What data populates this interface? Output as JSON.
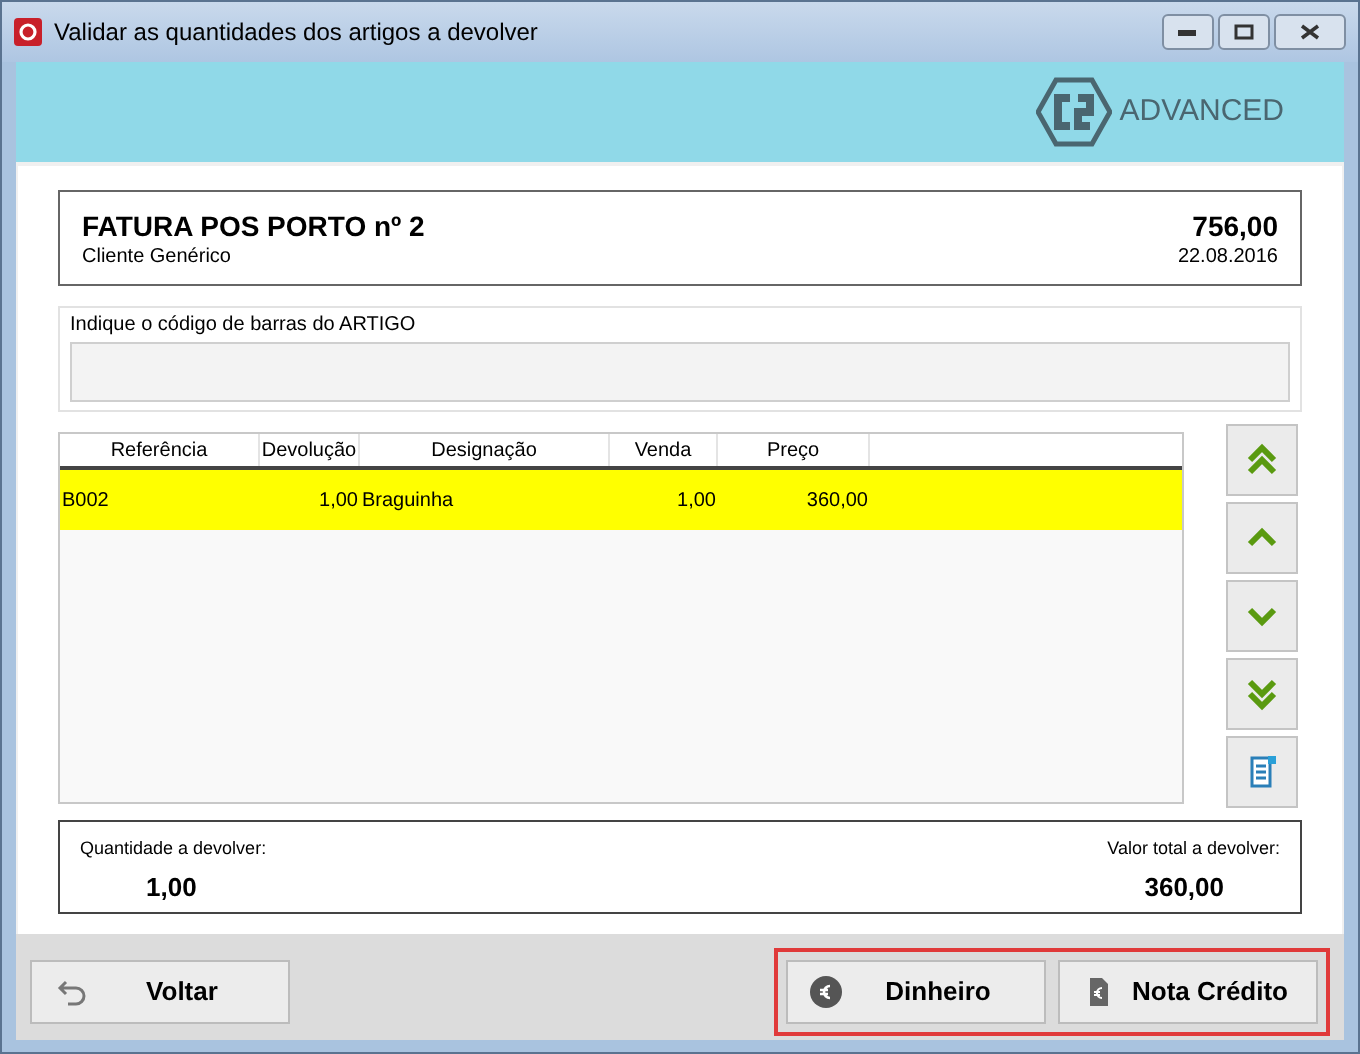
{
  "window": {
    "title": "Validar as quantidades dos artigos a devolver"
  },
  "header": {
    "logo_text": "ADVANCED"
  },
  "invoice": {
    "title": "FATURA POS PORTO nº 2",
    "customer": "Cliente Genérico",
    "total": "756,00",
    "date": "22.08.2016"
  },
  "barcode": {
    "label": "Indique o código de barras do ARTIGO"
  },
  "table": {
    "columns": [
      "Referência",
      "Devolução",
      "Designação",
      "Venda",
      "Preço"
    ],
    "rows": [
      {
        "cells": [
          "B002",
          "1,00",
          "Braguinha",
          "1,00",
          "360,00"
        ],
        "selected": true
      }
    ]
  },
  "nav_buttons": [
    {
      "kind": "first"
    },
    {
      "kind": "up"
    },
    {
      "kind": "down"
    },
    {
      "kind": "last"
    },
    {
      "kind": "calc"
    }
  ],
  "totals": {
    "quantity_label": "Quantidade a devolver:",
    "quantity": "1,00",
    "value_label": "Valor total a devolver:",
    "value": "360,00"
  },
  "buttons": [
    {
      "label": "Voltar",
      "kind": "back"
    }
  ],
  "highlighted_buttons": [
    {
      "label": "Dinheiro",
      "kind": "cash"
    },
    {
      "label": "Nota Crédito",
      "kind": "credit"
    }
  ]
}
